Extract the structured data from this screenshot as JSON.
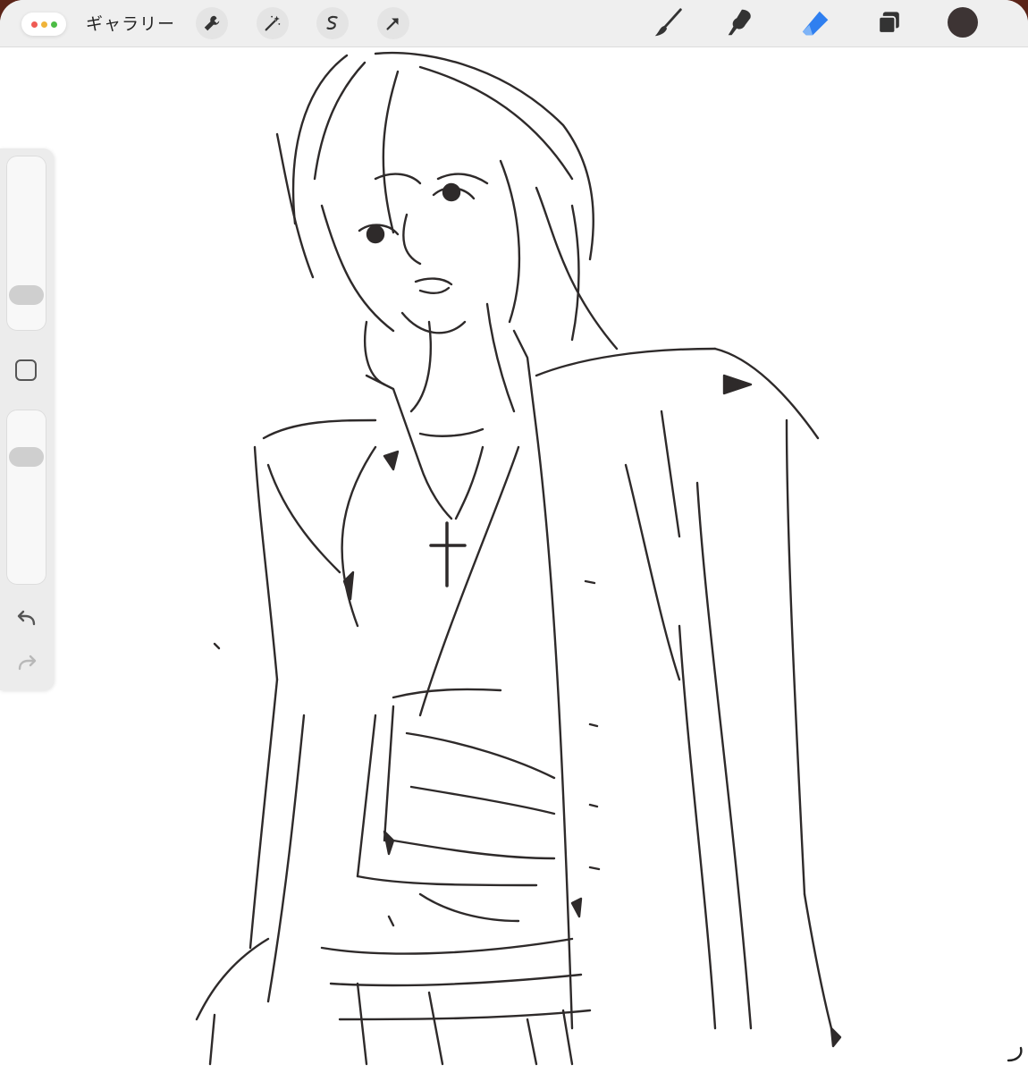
{
  "toolbar": {
    "gallery_label": "ギャラリー",
    "left_tools": [
      {
        "name": "actions",
        "icon": "wrench-icon"
      },
      {
        "name": "adjustments",
        "icon": "magic-wand-icon"
      },
      {
        "name": "selection",
        "icon": "selection-s-icon"
      },
      {
        "name": "transform",
        "icon": "arrow-cursor-icon"
      }
    ],
    "right_tools": [
      {
        "name": "brush",
        "icon": "brush-icon"
      },
      {
        "name": "smudge",
        "icon": "smudge-icon"
      },
      {
        "name": "eraser",
        "icon": "eraser-icon",
        "active": true
      },
      {
        "name": "layers",
        "icon": "layers-icon"
      },
      {
        "name": "color",
        "icon": "color-swatch"
      }
    ],
    "active_color": "#3d3434",
    "accent_color": "#2f7ff0"
  },
  "sidebar": {
    "brush_size_slider": {
      "icon": "size-slider"
    },
    "opacity_slider": {
      "icon": "opacity-slider"
    },
    "modify_button": {
      "icon": "square-icon"
    },
    "undo": {
      "icon": "undo-icon"
    },
    "redo": {
      "icon": "redo-icon",
      "enabled": false
    }
  },
  "canvas": {
    "content": "pencil-sketch",
    "background": "#ffffff"
  },
  "status": {
    "icon": "loading-spinner-icon"
  }
}
